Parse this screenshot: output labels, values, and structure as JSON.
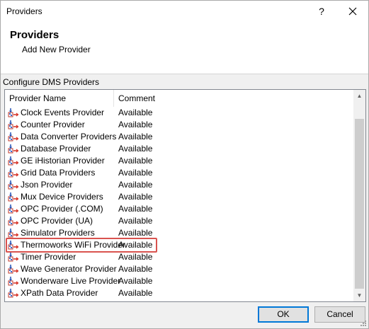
{
  "window": {
    "title": "Providers",
    "help_label": "?"
  },
  "header": {
    "title": "Providers",
    "subtitle": "Add New Provider"
  },
  "section_label": "Configure DMS Providers",
  "list": {
    "columns": {
      "name": "Provider Name",
      "comment": "Comment"
    },
    "rows": [
      {
        "name": "Clock Events Provider",
        "comment": "Available"
      },
      {
        "name": "Counter Provider",
        "comment": "Available"
      },
      {
        "name": "Data Converter Providers",
        "comment": "Available"
      },
      {
        "name": "Database Provider",
        "comment": "Available"
      },
      {
        "name": "GE iHistorian Provider",
        "comment": "Available"
      },
      {
        "name": "Grid Data Providers",
        "comment": "Available"
      },
      {
        "name": "Json Provider",
        "comment": "Available"
      },
      {
        "name": "Mux Device Providers",
        "comment": "Available"
      },
      {
        "name": "OPC Provider (.COM)",
        "comment": "Available"
      },
      {
        "name": "OPC Provider (UA)",
        "comment": "Available"
      },
      {
        "name": "Simulator Providers",
        "comment": "Available"
      },
      {
        "name": "Thermoworks WiFi Provider",
        "comment": "Available",
        "highlighted": true
      },
      {
        "name": "Timer Provider",
        "comment": "Available"
      },
      {
        "name": "Wave Generator Provider",
        "comment": "Available"
      },
      {
        "name": "Wonderware Live Provider",
        "comment": "Available"
      },
      {
        "name": "XPath Data Provider",
        "comment": "Available"
      }
    ],
    "row_icon": "provider-plugin-icon"
  },
  "buttons": {
    "ok": "OK",
    "cancel": "Cancel"
  },
  "colors": {
    "highlight_border": "#d9534f",
    "accent": "#0078d7"
  }
}
